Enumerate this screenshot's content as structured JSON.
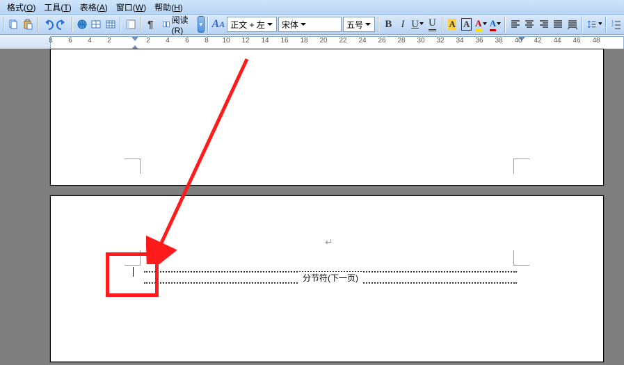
{
  "menu": {
    "format": {
      "label": "格式",
      "accel": "O"
    },
    "tools": {
      "label": "工具",
      "accel": "T"
    },
    "table": {
      "label": "表格",
      "accel": "A"
    },
    "window": {
      "label": "窗口",
      "accel": "W"
    },
    "help": {
      "label": "帮助",
      "accel": "H"
    }
  },
  "toolbar": {
    "reading_label": "阅读(R)",
    "style_value": "正文 + 左",
    "font_value": "宋体",
    "size_value": "五号"
  },
  "ruler_values": [
    "8",
    "6",
    "4",
    "2",
    "",
    "2",
    "4",
    "6",
    "8",
    "10",
    "12",
    "14",
    "16",
    "18",
    "20",
    "22",
    "24",
    "26",
    "28",
    "30",
    "32",
    "34",
    "36",
    "38",
    "40",
    "42",
    "44",
    "46",
    "48"
  ],
  "doc": {
    "section_break_text": "分节符(下一页)"
  }
}
